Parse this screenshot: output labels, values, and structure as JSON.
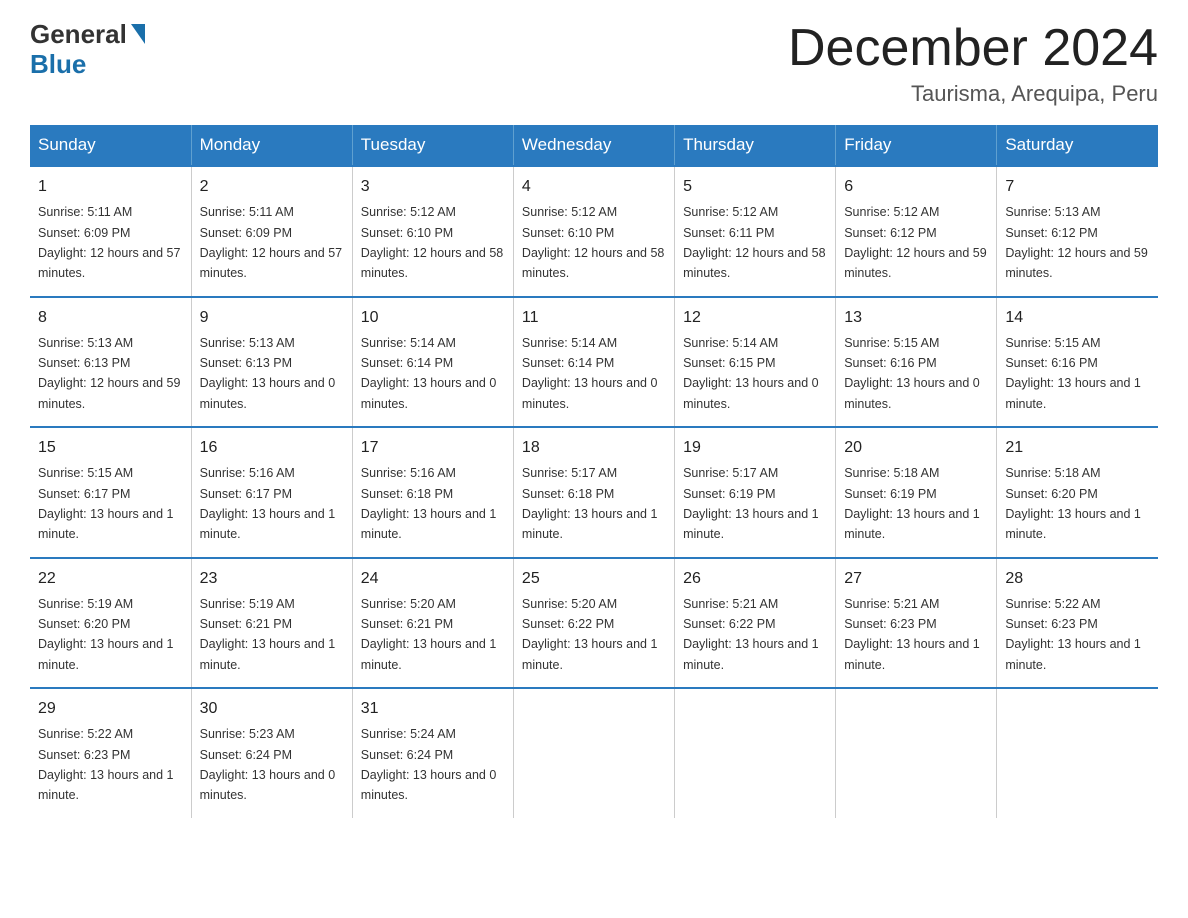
{
  "header": {
    "logo_general": "General",
    "logo_blue": "Blue",
    "month_title": "December 2024",
    "location": "Taurisma, Arequipa, Peru"
  },
  "days_of_week": [
    "Sunday",
    "Monday",
    "Tuesday",
    "Wednesday",
    "Thursday",
    "Friday",
    "Saturday"
  ],
  "weeks": [
    [
      {
        "day": "1",
        "sunrise": "5:11 AM",
        "sunset": "6:09 PM",
        "daylight": "12 hours and 57 minutes."
      },
      {
        "day": "2",
        "sunrise": "5:11 AM",
        "sunset": "6:09 PM",
        "daylight": "12 hours and 57 minutes."
      },
      {
        "day": "3",
        "sunrise": "5:12 AM",
        "sunset": "6:10 PM",
        "daylight": "12 hours and 58 minutes."
      },
      {
        "day": "4",
        "sunrise": "5:12 AM",
        "sunset": "6:10 PM",
        "daylight": "12 hours and 58 minutes."
      },
      {
        "day": "5",
        "sunrise": "5:12 AM",
        "sunset": "6:11 PM",
        "daylight": "12 hours and 58 minutes."
      },
      {
        "day": "6",
        "sunrise": "5:12 AM",
        "sunset": "6:12 PM",
        "daylight": "12 hours and 59 minutes."
      },
      {
        "day": "7",
        "sunrise": "5:13 AM",
        "sunset": "6:12 PM",
        "daylight": "12 hours and 59 minutes."
      }
    ],
    [
      {
        "day": "8",
        "sunrise": "5:13 AM",
        "sunset": "6:13 PM",
        "daylight": "12 hours and 59 minutes."
      },
      {
        "day": "9",
        "sunrise": "5:13 AM",
        "sunset": "6:13 PM",
        "daylight": "13 hours and 0 minutes."
      },
      {
        "day": "10",
        "sunrise": "5:14 AM",
        "sunset": "6:14 PM",
        "daylight": "13 hours and 0 minutes."
      },
      {
        "day": "11",
        "sunrise": "5:14 AM",
        "sunset": "6:14 PM",
        "daylight": "13 hours and 0 minutes."
      },
      {
        "day": "12",
        "sunrise": "5:14 AM",
        "sunset": "6:15 PM",
        "daylight": "13 hours and 0 minutes."
      },
      {
        "day": "13",
        "sunrise": "5:15 AM",
        "sunset": "6:16 PM",
        "daylight": "13 hours and 0 minutes."
      },
      {
        "day": "14",
        "sunrise": "5:15 AM",
        "sunset": "6:16 PM",
        "daylight": "13 hours and 1 minute."
      }
    ],
    [
      {
        "day": "15",
        "sunrise": "5:15 AM",
        "sunset": "6:17 PM",
        "daylight": "13 hours and 1 minute."
      },
      {
        "day": "16",
        "sunrise": "5:16 AM",
        "sunset": "6:17 PM",
        "daylight": "13 hours and 1 minute."
      },
      {
        "day": "17",
        "sunrise": "5:16 AM",
        "sunset": "6:18 PM",
        "daylight": "13 hours and 1 minute."
      },
      {
        "day": "18",
        "sunrise": "5:17 AM",
        "sunset": "6:18 PM",
        "daylight": "13 hours and 1 minute."
      },
      {
        "day": "19",
        "sunrise": "5:17 AM",
        "sunset": "6:19 PM",
        "daylight": "13 hours and 1 minute."
      },
      {
        "day": "20",
        "sunrise": "5:18 AM",
        "sunset": "6:19 PM",
        "daylight": "13 hours and 1 minute."
      },
      {
        "day": "21",
        "sunrise": "5:18 AM",
        "sunset": "6:20 PM",
        "daylight": "13 hours and 1 minute."
      }
    ],
    [
      {
        "day": "22",
        "sunrise": "5:19 AM",
        "sunset": "6:20 PM",
        "daylight": "13 hours and 1 minute."
      },
      {
        "day": "23",
        "sunrise": "5:19 AM",
        "sunset": "6:21 PM",
        "daylight": "13 hours and 1 minute."
      },
      {
        "day": "24",
        "sunrise": "5:20 AM",
        "sunset": "6:21 PM",
        "daylight": "13 hours and 1 minute."
      },
      {
        "day": "25",
        "sunrise": "5:20 AM",
        "sunset": "6:22 PM",
        "daylight": "13 hours and 1 minute."
      },
      {
        "day": "26",
        "sunrise": "5:21 AM",
        "sunset": "6:22 PM",
        "daylight": "13 hours and 1 minute."
      },
      {
        "day": "27",
        "sunrise": "5:21 AM",
        "sunset": "6:23 PM",
        "daylight": "13 hours and 1 minute."
      },
      {
        "day": "28",
        "sunrise": "5:22 AM",
        "sunset": "6:23 PM",
        "daylight": "13 hours and 1 minute."
      }
    ],
    [
      {
        "day": "29",
        "sunrise": "5:22 AM",
        "sunset": "6:23 PM",
        "daylight": "13 hours and 1 minute."
      },
      {
        "day": "30",
        "sunrise": "5:23 AM",
        "sunset": "6:24 PM",
        "daylight": "13 hours and 0 minutes."
      },
      {
        "day": "31",
        "sunrise": "5:24 AM",
        "sunset": "6:24 PM",
        "daylight": "13 hours and 0 minutes."
      },
      null,
      null,
      null,
      null
    ]
  ]
}
